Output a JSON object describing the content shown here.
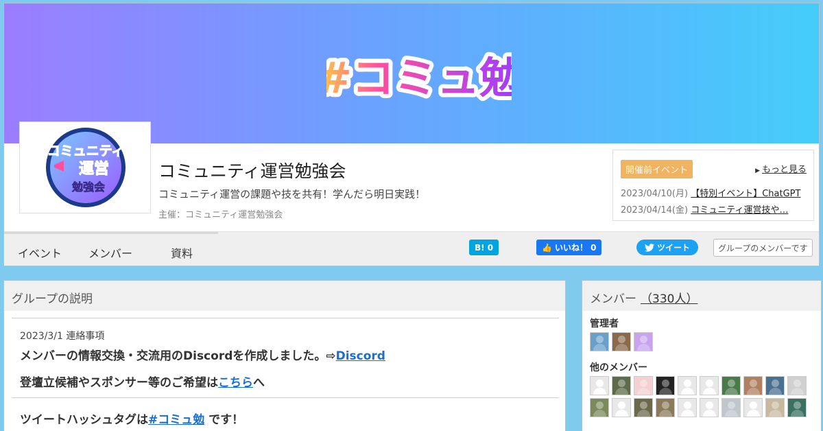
{
  "banner": {
    "logo_text": "#コミュ勉"
  },
  "group_logo": {
    "line1": "コミュニティ",
    "line2": "運営",
    "line3": "勉強会"
  },
  "group": {
    "title": "コミュニティ運営勉強会",
    "description": "コミュニティ運営の課題や技を共有！学んだら明日実践！",
    "host": "主催：コミュニティ運営勉強会"
  },
  "events": {
    "badge": "開催前イベント",
    "more_label": "もっと見る",
    "items": [
      {
        "date": "2023/04/10(月)",
        "title": "【特別イベント】ChatGPT"
      },
      {
        "date": "2023/04/14(金)",
        "title": "コミュニティ運営技や…"
      }
    ]
  },
  "tabs": [
    "イベント",
    "メンバー",
    "資料"
  ],
  "share": {
    "hatena": "B! 0",
    "facebook": "いいね！ 0",
    "tweet": "ツイート",
    "member_status": "グループのメンバーです"
  },
  "description_card": {
    "heading": "グループの説明",
    "notice_date": "2023/3/1 連絡事項",
    "discord_text": "メンバーの情報交換・交流用のDiscordを作成しました。⇨",
    "discord_link": "Discord",
    "sponsor_text_before": "登壇立候補やスポンサー等のご希望は",
    "sponsor_link": "こちら",
    "sponsor_text_after": "へ",
    "hashtag_before": "ツイートハッシュタグは",
    "hashtag_link": "#コミュ勉",
    "hashtag_after": " です！"
  },
  "members": {
    "heading": "メンバー",
    "count": "（330人）",
    "admins_label": "管理者",
    "others_label": "他のメンバー",
    "admin_avatars": [
      "#6aa0c8",
      "#8a6a4a",
      "#c9a3f0"
    ],
    "other_avatars": [
      "#e8e8e8",
      "#5d6b4a",
      "#f4d0d0",
      "#222222",
      "#e8e8e8",
      "#e8e8e8",
      "#4a7a4a",
      "#b08060",
      "#4a7090",
      "#d0d0d0",
      "#7a8a5a",
      "#e8e8e8",
      "#6a6a4a",
      "#8a7a5a",
      "#e8e8e8",
      "#e8e8e8",
      "#c0c6cc",
      "#e8e8e8",
      "#c8b8a0",
      "#3a7060"
    ]
  }
}
